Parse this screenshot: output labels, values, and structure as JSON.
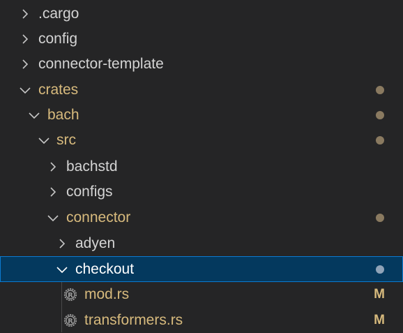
{
  "tree": {
    "items": [
      {
        "label": ".cargo",
        "type": "folder",
        "expanded": false,
        "modified": false,
        "selected": false
      },
      {
        "label": "config",
        "type": "folder",
        "expanded": false,
        "modified": false,
        "selected": false
      },
      {
        "label": "connector-template",
        "type": "folder",
        "expanded": false,
        "modified": false,
        "selected": false
      },
      {
        "label": "crates",
        "type": "folder",
        "expanded": true,
        "modified": true,
        "selected": false
      },
      {
        "label": "bach",
        "type": "folder",
        "expanded": true,
        "modified": true,
        "selected": false
      },
      {
        "label": "src",
        "type": "folder",
        "expanded": true,
        "modified": true,
        "selected": false
      },
      {
        "label": "bachstd",
        "type": "folder",
        "expanded": false,
        "modified": false,
        "selected": false
      },
      {
        "label": "configs",
        "type": "folder",
        "expanded": false,
        "modified": false,
        "selected": false
      },
      {
        "label": "connector",
        "type": "folder",
        "expanded": true,
        "modified": true,
        "selected": false
      },
      {
        "label": "adyen",
        "type": "folder",
        "expanded": false,
        "modified": false,
        "selected": false
      },
      {
        "label": "checkout",
        "type": "folder",
        "expanded": true,
        "modified": true,
        "selected": true
      },
      {
        "label": "mod.rs",
        "type": "file",
        "icon": "rust-file-icon",
        "badge": "M",
        "modified": true,
        "selected": false
      },
      {
        "label": "transformers.rs",
        "type": "file",
        "icon": "rust-file-icon",
        "badge": "M",
        "modified": true,
        "selected": false
      }
    ]
  },
  "colors": {
    "background": "#252526",
    "text": "#d4d4d4",
    "modified_text": "#d7ba7d",
    "selected_bg": "#04395e",
    "selected_border": "#0b7bd1"
  }
}
